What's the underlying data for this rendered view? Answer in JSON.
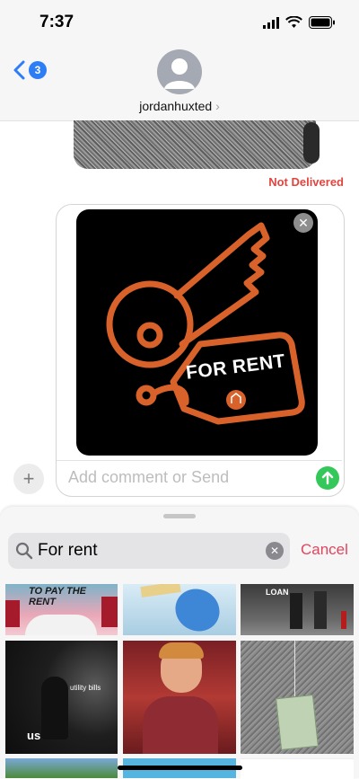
{
  "status_bar": {
    "time": "7:37"
  },
  "header": {
    "unread_count": "3",
    "contact_name": "jordanhuxted",
    "chevron": "›"
  },
  "conversation": {
    "delivery_status": "Not Delivered"
  },
  "compose": {
    "sticker_text": "FOR RENT",
    "placeholder": "Add comment or Send",
    "close_glyph": "✕",
    "plus_glyph": "+"
  },
  "search": {
    "query": "For rent",
    "cancel_label": "Cancel",
    "clear_glyph": "✕"
  },
  "gifs": [
    {
      "caption": "TO PAY THE RENT"
    },
    {
      "caption": ""
    },
    {
      "caption": "LOAN"
    },
    {
      "caption": "utility bills",
      "caption2": "us"
    },
    {
      "caption": ""
    },
    {
      "caption": ""
    }
  ],
  "colors": {
    "accent_blue": "#2c7df6",
    "error_red": "#e1453f",
    "send_green": "#34c759",
    "cancel_pink": "#e0455e",
    "sticker_orange": "#d9622b"
  }
}
